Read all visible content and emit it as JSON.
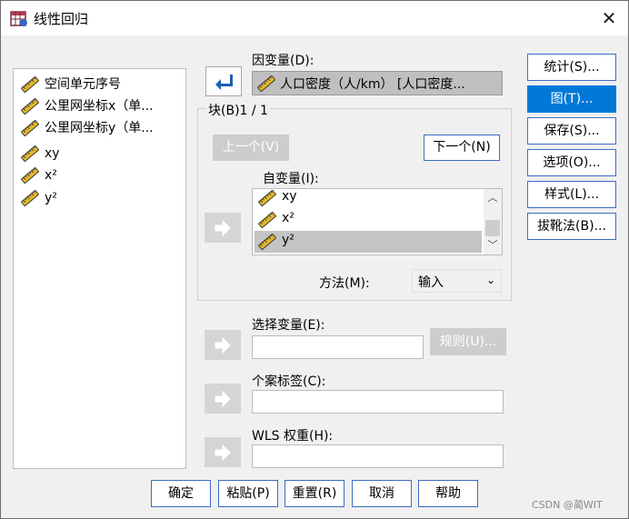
{
  "window": {
    "title": "线性回归",
    "close_glyph": "✕"
  },
  "variables": [
    {
      "label": "空间单元序号"
    },
    {
      "label": "公里网坐标x（单..."
    },
    {
      "label": "公里网坐标y（单..."
    },
    {
      "label": "xy"
    },
    {
      "label": "x²"
    },
    {
      "label": "y²"
    }
  ],
  "dependent": {
    "label": "因变量(D):",
    "value": "人口密度（人/km） [人口密度..."
  },
  "block": {
    "label": "块(B)1 / 1",
    "prev_button": "上一个(V)",
    "next_button": "下一个(N)"
  },
  "independent": {
    "label": "自变量(I):",
    "items": [
      {
        "label": "xy"
      },
      {
        "label": "x²"
      },
      {
        "label": "y²"
      }
    ],
    "selected_index": 2
  },
  "method": {
    "label": "方法(M):",
    "value": "输入"
  },
  "selection_variable": {
    "label": "选择变量(E):",
    "rule_button": "规则(U)..."
  },
  "case_labels": {
    "label": "个案标签(C):"
  },
  "wls_weight": {
    "label": "WLS 权重(H):"
  },
  "side_buttons": {
    "statistics": "统计(S)...",
    "plots": "图(T)...",
    "save": "保存(S)...",
    "options": "选项(O)...",
    "style": "样式(L)...",
    "bootstrap": "拔靴法(B)..."
  },
  "bottom_buttons": {
    "ok": "确定",
    "paste": "粘贴(P)",
    "reset": "重置(R)",
    "cancel": "取消",
    "help": "帮助"
  },
  "watermark": "CSDN @蔺WIT",
  "colors": {
    "accent": "#0078d7",
    "button_border": "#3d6cc1",
    "scale_icon": "#c8a11a"
  },
  "icons": {
    "variable": "scale-ruler-icon",
    "move_arrow": "right-arrow-icon",
    "dependent_arrow": "left-return-arrow-icon"
  }
}
